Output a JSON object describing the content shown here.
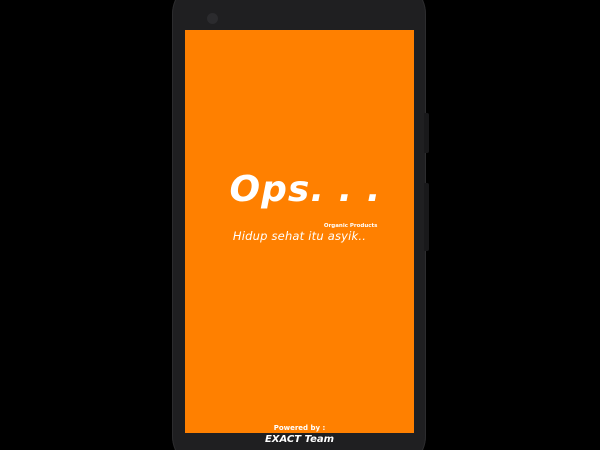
{
  "splash": {
    "logo_text": "Ops. . .",
    "logo_subtitle": "Organic Products",
    "tagline": "Hidup sehat itu asyik..",
    "powered_by_label": "Powered by :",
    "team_name": "EXACT Team"
  },
  "colors": {
    "screen_background": "#ff8000",
    "text": "#ffffff",
    "device_body": "#1f1f21",
    "page_background": "#000000"
  }
}
